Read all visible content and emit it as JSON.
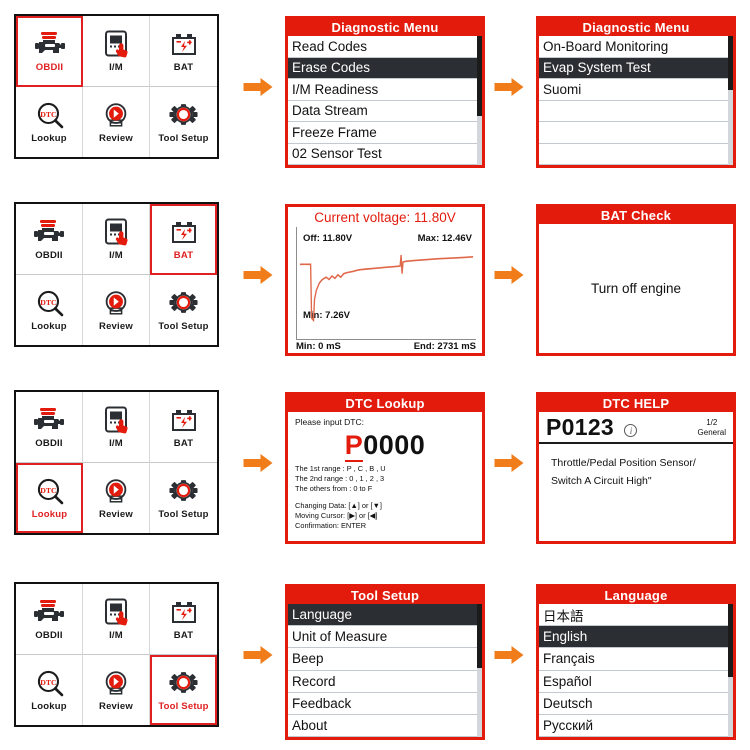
{
  "menu": {
    "items": [
      {
        "label": "OBDII",
        "icon": "engine-icon"
      },
      {
        "label": "I/M",
        "icon": "tablet-hand-icon"
      },
      {
        "label": "BAT",
        "icon": "battery-icon"
      },
      {
        "label": "Lookup",
        "icon": "dtc-magnifier-icon"
      },
      {
        "label": "Review",
        "icon": "play-arrow-icon"
      },
      {
        "label": "Tool Setup",
        "icon": "gear-icon"
      }
    ],
    "selected": [
      "OBDII",
      "BAT",
      "Lookup",
      "Tool Setup"
    ]
  },
  "arrow_icon": "right-arrow-icon",
  "rows": [
    {
      "selected_menu_item": "OBDII",
      "screen_a": {
        "title": "Diagnostic Menu",
        "items": [
          {
            "label": "Read Codes",
            "selected": false
          },
          {
            "label": "Erase Codes",
            "selected": true
          },
          {
            "label": "I/M Readiness",
            "selected": false
          },
          {
            "label": "Data Stream",
            "selected": false
          },
          {
            "label": "Freeze Frame",
            "selected": false
          },
          {
            "label": "02 Sensor Test",
            "selected": false
          }
        ],
        "scroll_top_pct": 0,
        "scroll_height_pct": 62
      },
      "screen_b": {
        "title": "Diagnostic Menu",
        "items": [
          {
            "label": "On-Board Monitoring",
            "selected": false
          },
          {
            "label": "Evap System Test",
            "selected": true
          },
          {
            "label": "Suomi",
            "selected": false
          },
          {
            "label": "",
            "selected": false
          },
          {
            "label": "",
            "selected": false
          },
          {
            "label": "",
            "selected": false
          }
        ],
        "scroll_top_pct": 0,
        "scroll_height_pct": 42
      }
    },
    {
      "selected_menu_item": "BAT",
      "screen_a": {
        "header": "Current voltage: 11.80V",
        "label_off": "Off: 11.80V",
        "label_max": "Max: 12.46V",
        "label_min": "Min: 7.26V",
        "foot_left": "Min: 0 mS",
        "foot_right": "End: 2731 mS"
      },
      "screen_b": {
        "title": "BAT Check",
        "message": "Turn off engine"
      }
    },
    {
      "selected_menu_item": "Lookup",
      "screen_a": {
        "title": "DTC Lookup",
        "prompt": "Please input DTC:",
        "code_highlight": "P",
        "code_rest": "0000",
        "rules": [
          "The 1st range : P , C , B , U",
          "The 2nd range : 0 , 1 , 2 , 3",
          "The others from : 0 to F"
        ],
        "keys": [
          "Changing Data: [▲] or [▼]",
          "Moving Cursor:  [▶] or [◀]",
          "Confirmation:  ENTER"
        ]
      },
      "screen_b": {
        "title": "DTC HELP",
        "code": "P0123",
        "info_icon": "info-icon",
        "page": "1/2",
        "scope": "General",
        "description_lines": [
          "Throttle/Pedal Position Sensor/",
          "Switch A Circuit High\""
        ]
      }
    },
    {
      "selected_menu_item": "Tool Setup",
      "screen_a": {
        "title": "Tool Setup",
        "items": [
          {
            "label": "Language",
            "selected": true
          },
          {
            "label": "Unit of Measure",
            "selected": false
          },
          {
            "label": "Beep",
            "selected": false
          },
          {
            "label": "Record",
            "selected": false
          },
          {
            "label": "Feedback",
            "selected": false
          },
          {
            "label": "About",
            "selected": false
          }
        ],
        "scroll_top_pct": 0,
        "scroll_height_pct": 48
      },
      "screen_b": {
        "title": "Language",
        "items": [
          {
            "label": "日本語",
            "selected": false
          },
          {
            "label": "English",
            "selected": true
          },
          {
            "label": "Français",
            "selected": false
          },
          {
            "label": "Español",
            "selected": false
          },
          {
            "label": "Deutsch",
            "selected": false
          },
          {
            "label": "Русский",
            "selected": false
          }
        ],
        "scroll_top_pct": 0,
        "scroll_height_pct": 55
      }
    }
  ],
  "colors": {
    "red": "#e31b0c",
    "orange": "#f07d1a",
    "dark": "#2b2f33",
    "line": "#c4c9cf"
  }
}
